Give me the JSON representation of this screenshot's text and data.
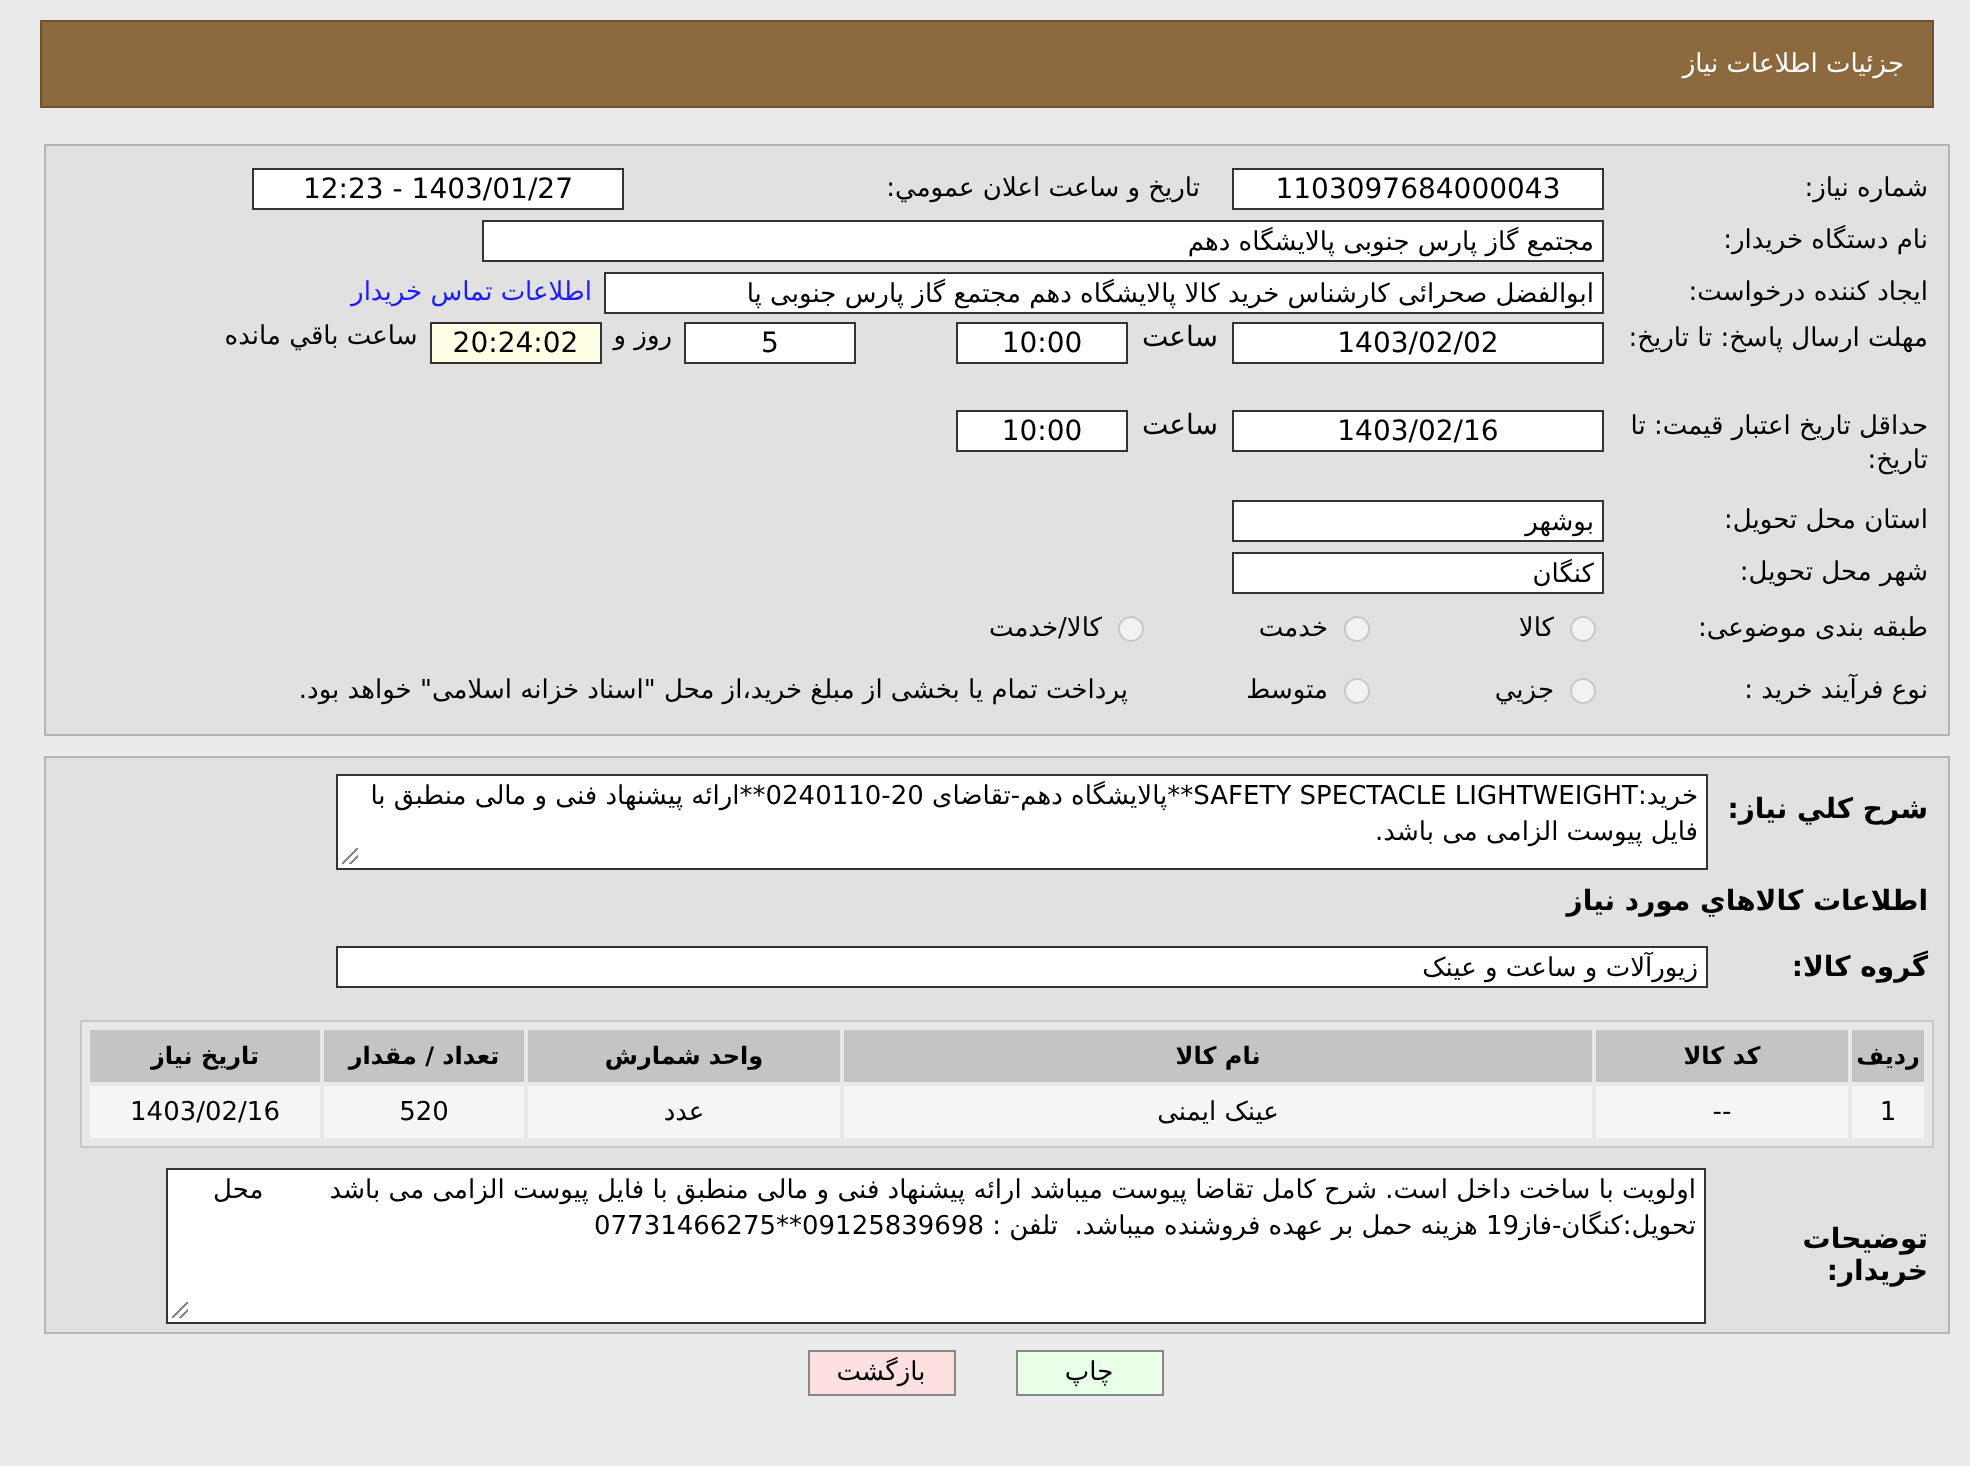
{
  "header": {
    "title": "جزئیات اطلاعات نیاز"
  },
  "need_number": {
    "label": "شماره نیاز:",
    "value": "1103097684000043"
  },
  "announce": {
    "label": "تاریخ و ساعت اعلان عمومي:",
    "value": "1403/01/27 - 12:23"
  },
  "buyer_org": {
    "label": "نام دستگاه خریدار:",
    "value": "مجتمع گاز پارس جنوبی  پالایشگاه دهم"
  },
  "requester": {
    "label": "ایجاد کننده درخواست:",
    "value": "ابوالفضل صحرائی کارشناس خرید کالا پالایشگاه دهم مجتمع گاز پارس جنوبی  پا",
    "contact_link": "اطلاعات تماس خریدار"
  },
  "reply_deadline": {
    "label": "مهلت ارسال پاسخ: تا تاریخ:",
    "date": "1403/02/02",
    "time_label": "ساعت",
    "time": "10:00",
    "days": "5",
    "days_label": "روز و",
    "remaining": "20:24:02",
    "remaining_label": "ساعت باقي مانده"
  },
  "price_validity": {
    "label": "حداقل تاریخ اعتبار قیمت: تا تاریخ:",
    "date": "1403/02/16",
    "time_label": "ساعت",
    "time": "10:00"
  },
  "province": {
    "label": "استان محل تحویل:",
    "value": "بوشهر"
  },
  "city": {
    "label": "شهر محل تحویل:",
    "value": "کنگان"
  },
  "category": {
    "label": "طبقه بندی موضوعی:",
    "options": [
      {
        "label": "کالا",
        "selected": false
      },
      {
        "label": "خدمت",
        "selected": false
      },
      {
        "label": "کالا/خدمت",
        "selected": false
      }
    ]
  },
  "purchase_type": {
    "label": "نوع فرآیند خرید :",
    "options": [
      {
        "label": "جزيي",
        "selected": false
      },
      {
        "label": "متوسط",
        "selected": false
      }
    ],
    "note": "پرداخت تمام یا بخشی از مبلغ خرید،از محل \"اسناد خزانه اسلامی\" خواهد بود."
  },
  "summary": {
    "label": "شرح کلي نیاز:",
    "value": "خرید:SAFETY SPECTACLE  LIGHTWEIGHT**پالایشگاه دهم-تقاضای 20-0240110**ارائه پیشنهاد فنی و مالی منطبق با فایل پیوست الزامی می باشد."
  },
  "goods_heading": "اطلاعات کالاهاي مورد نیاز",
  "goods_group": {
    "label": "گروه کالا:",
    "value": "زیورآلات و ساعت و عینک"
  },
  "table": {
    "columns": [
      "ردیف",
      "کد کالا",
      "نام کالا",
      "واحد شمارش",
      "تعداد / مقدار",
      "تاریخ نیاز"
    ],
    "rows": [
      [
        "1",
        "--",
        "عینک ایمنی",
        "عدد",
        "520",
        "1403/02/16"
      ]
    ]
  },
  "buyer_notes": {
    "label": "توضیحات خریدار:",
    "value": "اولویت با ساخت داخل است. شرح کامل تقاضا پیوست میباشد ارائه پیشنهاد فنی و مالی منطبق با فایل پیوست الزامی می باشد        محل تحویل:کنگان-فاز19 هزینه حمل بر عهده فروشنده میباشد.  تلفن : 09125839698**07731466275"
  },
  "buttons": [
    {
      "label": "چاپ",
      "kind": "print"
    },
    {
      "label": "بازگشت",
      "kind": "back"
    }
  ]
}
